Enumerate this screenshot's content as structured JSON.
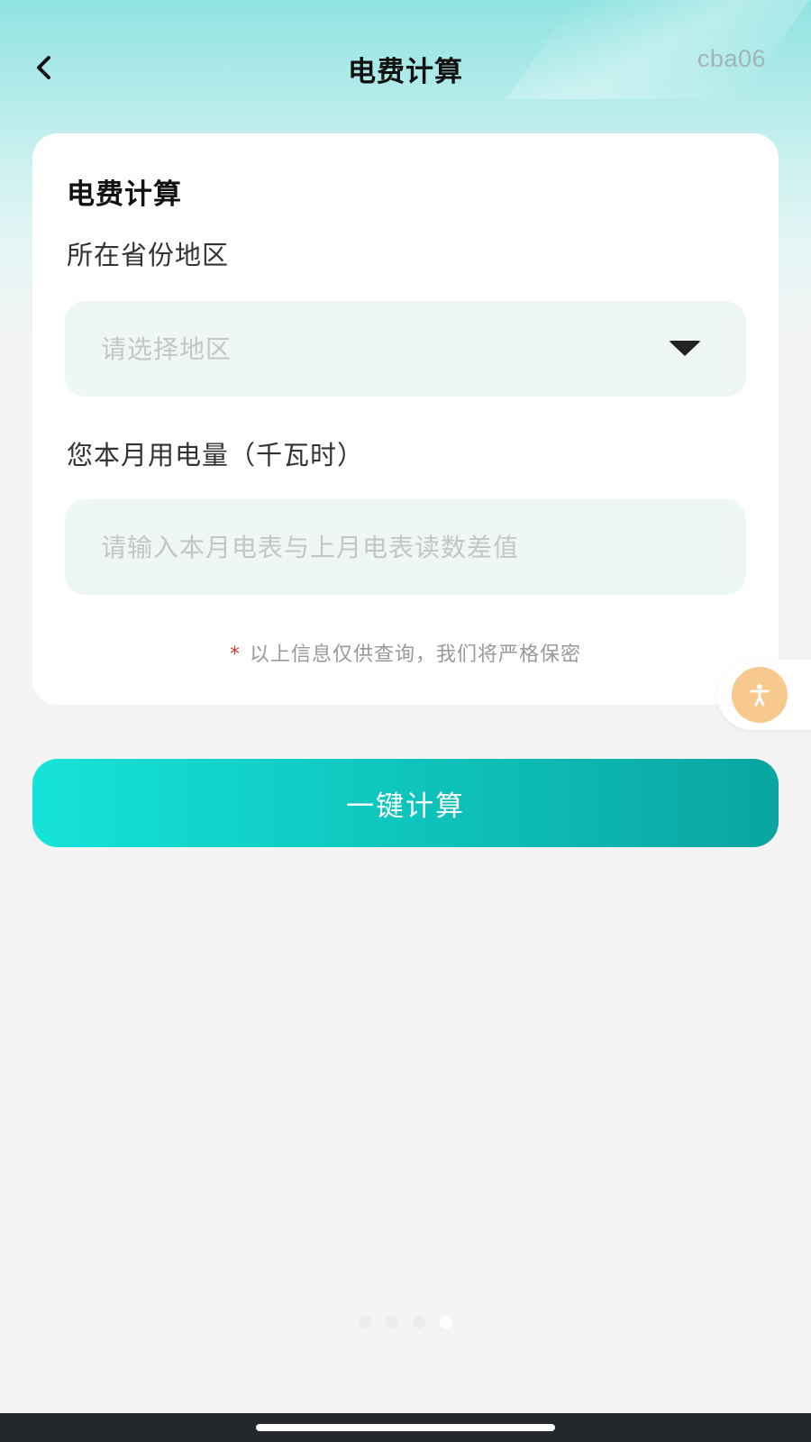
{
  "nav": {
    "title": "电费计算",
    "code": "cba06",
    "back_icon": "chevron-left-icon"
  },
  "card": {
    "title": "电费计算",
    "region": {
      "label": "所在省份地区",
      "placeholder": "请选择地区",
      "icon": "triangle-down-icon"
    },
    "usage": {
      "label": "您本月用电量（千瓦时）",
      "placeholder": "请输入本月电表与上月电表读数差值",
      "value": ""
    },
    "privacy_mark": "*",
    "privacy_note": "以上信息仅供查询，我们将严格保密"
  },
  "floating_button": {
    "icon": "accessibility-icon"
  },
  "calculate_button": {
    "label": "一键计算"
  },
  "pagination": {
    "count": 4,
    "active_index": 3
  },
  "colors": {
    "accent_start": "#15e3d9",
    "accent_end": "#0aa59f",
    "header_bg": "#8fe3e1",
    "page_bg": "#f4f4f4",
    "required_mark": "#d33a2f"
  }
}
